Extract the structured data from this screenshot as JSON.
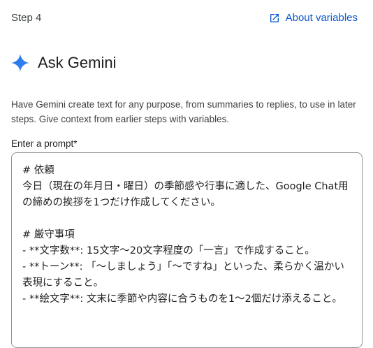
{
  "header": {
    "step": "Step 4",
    "about_link": "About variables",
    "about_icon": "open-in-new-icon"
  },
  "section": {
    "title": "Ask Gemini",
    "title_icon": "gemini-sparkle-icon",
    "description": "Have Gemini create text for any purpose, from summaries to replies, to use in later steps. Give context from earlier steps with variables."
  },
  "prompt": {
    "label": "Enter a prompt*",
    "value": "# 依頼\n今日（現在の年月日・曜日）の季節感や行事に適した、Google Chat用の締めの挨拶を1つだけ作成してください。\n\n# 厳守事項\n- **文字数**: 15文字〜20文字程度の「一言」で作成すること。\n- **トーン**: 「〜しましょう」「〜ですね」といった、柔らかく温かい表現にすること。\n- **絵文字**: 文末に季節や内容に合うものを1〜2個だけ添えること。"
  },
  "colors": {
    "accent": "#0b57d0",
    "gemini_gradient_start": "#1a73e8",
    "gemini_gradient_end": "#4285f4",
    "border": "#8e918f"
  }
}
